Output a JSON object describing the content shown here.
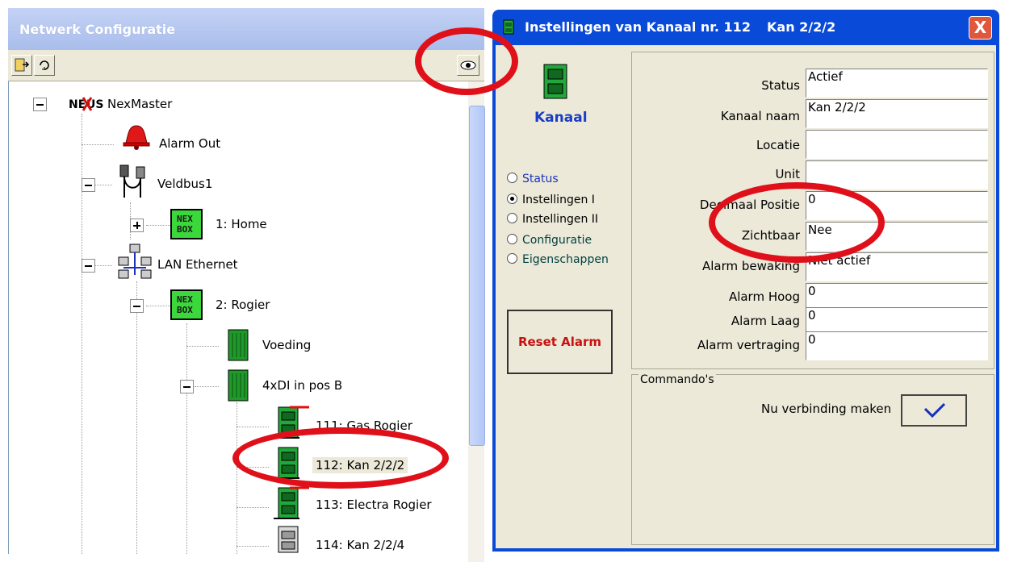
{
  "left_window": {
    "title": "Netwerk Configuratie"
  },
  "toolbar": {
    "exit_icon": "exit-door-icon",
    "refresh_icon": "refresh-icon",
    "view_icon": "eye-icon"
  },
  "tree": {
    "nodes": [
      {
        "label": "NexMaster",
        "icon": "nexus-logo"
      },
      {
        "label": "Alarm Out",
        "icon": "alarm-bell-icon"
      },
      {
        "label": "Veldbus1",
        "icon": "fieldbus-connector-icon"
      },
      {
        "label": "1: Home",
        "icon": "nexbox-icon"
      },
      {
        "label": "LAN Ethernet",
        "icon": "network-icon"
      },
      {
        "label": "2: Rogier",
        "icon": "nexbox-icon"
      },
      {
        "label": "Voeding",
        "icon": "module-icon"
      },
      {
        "label": "4xDI in pos B",
        "icon": "module-icon"
      },
      {
        "label": "111: Gas Rogier",
        "icon": "channel-cabinet-icon"
      },
      {
        "label": "112: Kan 2/2/2",
        "icon": "channel-cabinet-icon"
      },
      {
        "label": "113: Electra Rogier",
        "icon": "channel-cabinet-icon"
      },
      {
        "label": "114: Kan 2/2/4",
        "icon": "channel-cabinet-grey-icon"
      }
    ]
  },
  "dialog": {
    "title": "Instellingen van Kanaal nr. 112",
    "title_channel": "Kan 2/2/2",
    "close_label": "X",
    "kanaal_heading": "Kanaal",
    "radio_options": [
      "Status",
      "Instellingen I",
      "Instellingen II",
      "Configuratie",
      "Eigenschappen"
    ],
    "selected_radio": "Instellingen I",
    "reset_alarm_label": "Reset Alarm",
    "properties": [
      {
        "label": "Status",
        "value": "Actief"
      },
      {
        "label": "Kanaal naam",
        "value": "Kan 2/2/2"
      },
      {
        "label": "Locatie",
        "value": ""
      },
      {
        "label": "Unit",
        "value": ""
      },
      {
        "label": "Decimaal Positie",
        "value": "0"
      },
      {
        "label": "Zichtbaar",
        "value": "Nee"
      },
      {
        "label": "Alarm bewaking",
        "value": "Niet actief"
      },
      {
        "label": "Alarm Hoog",
        "value": "0"
      },
      {
        "label": "Alarm Laag",
        "value": "0"
      },
      {
        "label": "Alarm vertraging",
        "value": "0"
      }
    ],
    "commands_legend": "Commando's",
    "connect_label": "Nu verbinding maken"
  },
  "colors": {
    "titlebar_blue": "#0a4ad8",
    "highlight_red": "#e0101a",
    "kanaal_blue": "#1a3cc8",
    "reset_red": "#c81212"
  }
}
